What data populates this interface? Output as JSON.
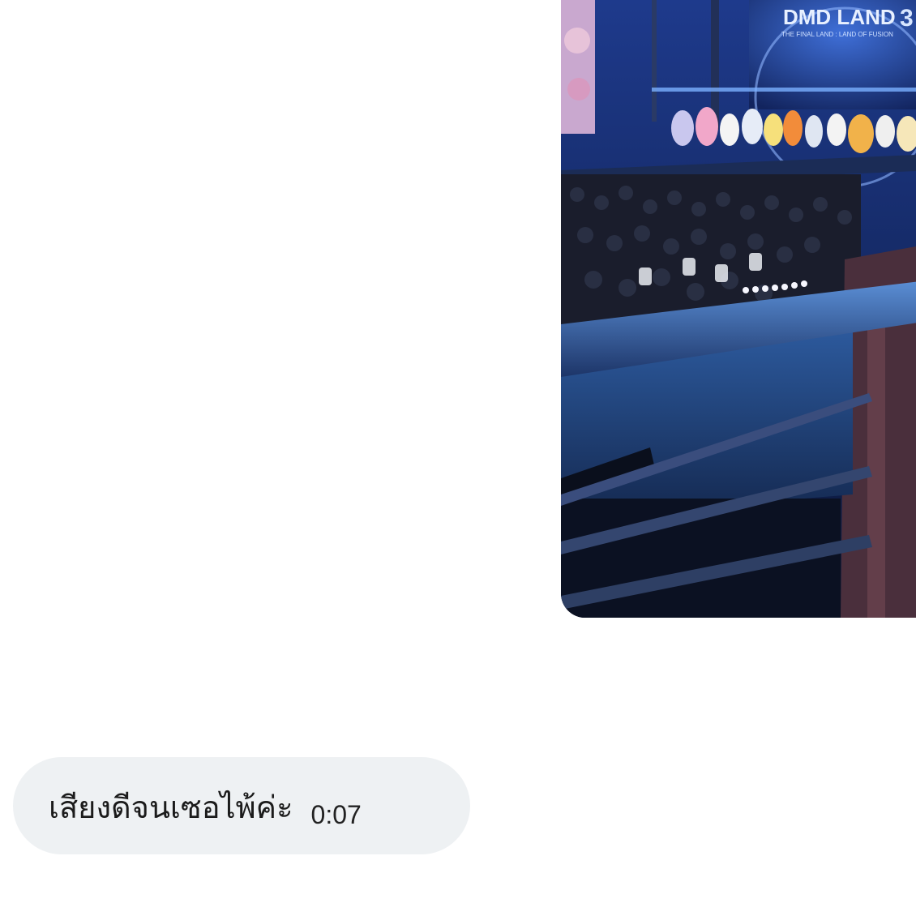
{
  "media_message": {
    "photo": {
      "screen_logo_title": "DMD LAND",
      "screen_logo_number": "3",
      "screen_logo_subtitle": "THE FINAL LAND : LAND OF FUSION"
    }
  },
  "message": {
    "text": "เสียงดีจนเซอไพ้ค่ะ",
    "duration": "0:07"
  }
}
